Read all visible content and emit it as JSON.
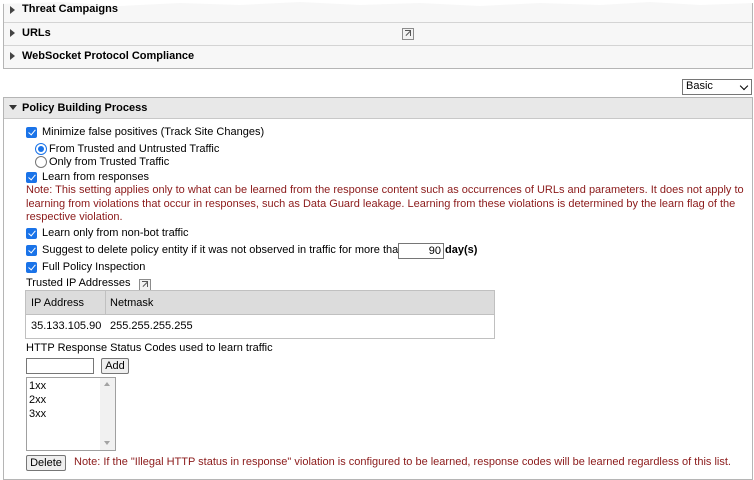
{
  "top_sections": [
    {
      "label": "Threat Campaigns"
    },
    {
      "label": "URLs"
    },
    {
      "label": "WebSocket Protocol Compliance"
    }
  ],
  "view_select": {
    "value": "Basic"
  },
  "panel": {
    "title": "Policy Building Process",
    "minimize_fp": {
      "label": "Minimize false positives (Track Site Changes)",
      "checked": true
    },
    "radio_trusted_untrusted": {
      "label": "From Trusted and Untrusted Traffic",
      "selected": true
    },
    "radio_trusted_only": {
      "label": "Only from Trusted Traffic",
      "selected": false
    },
    "learn_responses": {
      "label": "Learn from responses",
      "checked": true
    },
    "note_responses_1": "Note: This setting applies only to what can be learned from the response content such as occurrences of URLs and parameters. It does not apply to",
    "note_responses_2": "learning from violations that occur in responses, such as Data Guard leakage. Learning from these violations is determined by the learn flag of the",
    "note_responses_3": "respective violation.",
    "learn_non_bot": {
      "label": "Learn only from non-bot traffic",
      "checked": true
    },
    "suggest_delete": {
      "label": "Suggest to delete policy entity if it was not observed in traffic for more than",
      "checked": true,
      "days": "90",
      "unit": "day(s)"
    },
    "full_inspection": {
      "label": "Full Policy Inspection",
      "checked": true
    },
    "trusted_ip": {
      "label": "Trusted IP Addresses",
      "columns": [
        "IP Address",
        "Netmask"
      ],
      "rows": [
        [
          "35.133.105.90",
          "255.255.255.255"
        ]
      ]
    },
    "status_codes": {
      "label": "HTTP Response Status Codes used to learn traffic",
      "input_value": "",
      "add_label": "Add",
      "items": [
        "1xx",
        "2xx",
        "3xx"
      ],
      "delete_label": "Delete",
      "note": "Note: If the \"Illegal HTTP status in response\" violation is configured to be learned, response codes will be learned regardless of this list."
    }
  }
}
